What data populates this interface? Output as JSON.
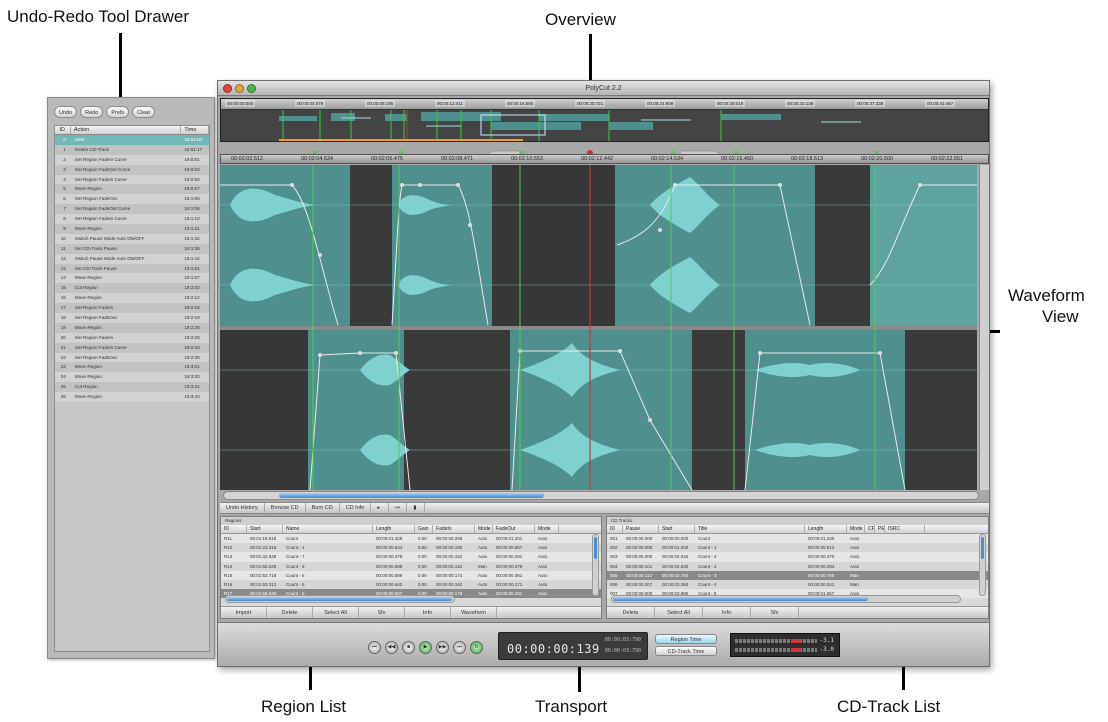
{
  "callouts": {
    "drawer": "Undo-Redo Tool Drawer",
    "overview": "Overview",
    "waveform_line1": "Waveform",
    "waveform_line2": "View",
    "region_list": "Region List",
    "transport": "Transport",
    "cd_track_list": "CD-Track List"
  },
  "window": {
    "title": "PolyCut 2.2"
  },
  "drawer": {
    "buttons": [
      "Undo",
      "Redo",
      "Prefs",
      "Clear"
    ],
    "columns": [
      "ID",
      "Action",
      "Time"
    ],
    "rows": [
      {
        "id": "0",
        "action": "Start",
        "time": "18:51:04",
        "selected": true
      },
      {
        "id": "1",
        "action": "Delete CD-Track",
        "time": "18:51:17"
      },
      {
        "id": "2",
        "action": "Set Region FadeIn Curve",
        "time": "19:0:51"
      },
      {
        "id": "3",
        "action": "Set Region FadeOut Curve",
        "time": "19:0:53"
      },
      {
        "id": "4",
        "action": "Set Region FadeIn Curve",
        "time": "19:0:55"
      },
      {
        "id": "5",
        "action": "Move Region",
        "time": "19:0:57"
      },
      {
        "id": "6",
        "action": "Set Region FadeOut",
        "time": "19:1:06"
      },
      {
        "id": "7",
        "action": "Set Region FadeOut Curve",
        "time": "19:1:08"
      },
      {
        "id": "8",
        "action": "Set Region FadeIn Curve",
        "time": "19:1:10"
      },
      {
        "id": "9",
        "action": "Move Region",
        "time": "19:1:21"
      },
      {
        "id": "10",
        "action": "Switch Pause Mode Auto ON/OFF",
        "time": "19:1:34"
      },
      {
        "id": "11",
        "action": "Set CD-Track Pause",
        "time": "19:1:38"
      },
      {
        "id": "12",
        "action": "Switch Pause Mode Auto ON/OFF",
        "time": "19:1:44"
      },
      {
        "id": "13",
        "action": "Set CD-Track Pause",
        "time": "19:1:51"
      },
      {
        "id": "14",
        "action": "Move Region",
        "time": "19:1:57"
      },
      {
        "id": "15",
        "action": "Cut Region",
        "time": "19:2:02"
      },
      {
        "id": "16",
        "action": "Move Region",
        "time": "19:2:12"
      },
      {
        "id": "17",
        "action": "Set Region FadeIn",
        "time": "19:2:16"
      },
      {
        "id": "18",
        "action": "Set Region FadeOut",
        "time": "19:2:19"
      },
      {
        "id": "19",
        "action": "Move Region",
        "time": "19:2:26"
      },
      {
        "id": "20",
        "action": "Set Region FadeIn",
        "time": "19:2:29"
      },
      {
        "id": "21",
        "action": "Set Region FadeIn Curve",
        "time": "19:2:33"
      },
      {
        "id": "22",
        "action": "Set Region FadeOut",
        "time": "19:2:36"
      },
      {
        "id": "23",
        "action": "Move Region",
        "time": "19:3:01"
      },
      {
        "id": "24",
        "action": "Move Region",
        "time": "19:3:33"
      },
      {
        "id": "25",
        "action": "Cut Region",
        "time": "19:3:41"
      },
      {
        "id": "26",
        "action": "Move Region",
        "time": "19:3:43"
      }
    ]
  },
  "overview": {
    "timestamps": [
      "00:00:00:000",
      "00:00:04:079",
      "00:00:08:195",
      "00:00:12:411",
      "00:00:16:590",
      "00:00:20:721",
      "00:00:24:909",
      "00:00:29:019",
      "00:00:33:138",
      "00:00:37:338",
      "00:00:41:467"
    ]
  },
  "ruler": {
    "timestamps": [
      "00:02:02.512",
      "00:02:04.534",
      "00:02:06.475",
      "00:02:08.471",
      "00:02:10.553",
      "00:02:12.442",
      "00:02:14.534",
      "00:02:16.450",
      "00:02:18.513",
      "00:02:20.500",
      "00:02:22.551"
    ]
  },
  "toolbar": {
    "buttons": [
      "Undo History",
      "Browse CD",
      "Burn CD",
      "CD Info"
    ]
  },
  "regions": {
    "title": "Regions",
    "columns": [
      "ID",
      "Start",
      "Name",
      "Length",
      "Gain",
      "FadeIn",
      "Mode",
      "FadeOut",
      "Mode"
    ],
    "rows": [
      {
        "id": "R11",
        "start": "00:01:18.818",
        "name": "Count",
        "length": "00:00:01.428",
        "gain": "0.00",
        "fadein": "00:00:00.268",
        "mode": "Auto",
        "fadeout": "00:00:01.201",
        "mode2": "Auto"
      },
      {
        "id": "R12",
        "start": "00:01:23.318",
        "name": "Count - 1",
        "length": "00:00:00.844",
        "gain": "0.00",
        "fadein": "00:00:00.190",
        "mode": "Auto",
        "fadeout": "00:00:00.657",
        "mode2": "Auto"
      },
      {
        "id": "R13",
        "start": "00:01:32.848",
        "name": "Count - 7",
        "length": "00:00:00.478",
        "gain": "0.00",
        "fadein": "00:00:00.152",
        "mode": "Auto",
        "fadeout": "00:00:00.281",
        "mode2": "Auto"
      },
      {
        "id": "R14",
        "start": "00:01:50.228",
        "name": "Count - 3",
        "length": "00:00:00.698",
        "gain": "0.00",
        "fadein": "00:00:00.118",
        "mode": "Man",
        "fadeout": "00:00:00.279",
        "mode2": "Auto"
      },
      {
        "id": "R15",
        "start": "00:01:52.718",
        "name": "Count - 5",
        "length": "00:00:00.588",
        "gain": "0.00",
        "fadein": "00:00:00.174",
        "mode": "Auto",
        "fadeout": "00:00:00.361",
        "mode2": "Auto"
      },
      {
        "id": "R16",
        "start": "00:01:53.313",
        "name": "Count - 5",
        "length": "00:00:00.542",
        "gain": "0.00",
        "fadein": "00:00:00.162",
        "mode": "Auto",
        "fadeout": "00:00:00.271",
        "mode2": "Auto"
      },
      {
        "id": "R17",
        "start": "00:01:59.635",
        "name": "Count - 6",
        "length": "00:00:00.927",
        "gain": "0.00",
        "fadein": "00:00:00.178",
        "mode": "Auto",
        "fadeout": "00:00:00.481",
        "mode2": "Auto",
        "selected": true
      }
    ],
    "buttons": [
      "Import",
      "Delete",
      "Select All",
      "Sfx",
      "Info",
      "Waveform"
    ]
  },
  "cdtracks": {
    "title": "CD Tracks",
    "columns": [
      "ID",
      "Pause",
      "Start",
      "Title",
      "Length",
      "Mode",
      "CP",
      "PE",
      "ISRC"
    ],
    "rows": [
      {
        "id": "001",
        "pause": "00:00:00.000",
        "start": "00:00:00.000",
        "title": "Count",
        "length": "00:00:01.230",
        "mode": "Auto"
      },
      {
        "id": "002",
        "pause": "00:00:00.000",
        "start": "00:00:01.200",
        "title": "Count - 1",
        "length": "00:00:00.613",
        "mode": "Auto"
      },
      {
        "id": "003",
        "pause": "00:00:00.000",
        "start": "00:00:02.045",
        "title": "Count - 2",
        "length": "00:00:00.470",
        "mode": "Auto"
      },
      {
        "id": "004",
        "pause": "00:00:00.101",
        "start": "00:00:02.830",
        "title": "Count - 2",
        "length": "00:00:00.294",
        "mode": "Auto"
      },
      {
        "id": "005",
        "pause": "00:00:00.113",
        "start": "00:00:02.750",
        "title": "Count - 3",
        "length": "00:00:00.780",
        "mode": "Man",
        "selected": true
      },
      {
        "id": "006",
        "pause": "00:00:00.207",
        "start": "00:00:03.393",
        "title": "Count - 4",
        "length": "00:00:00.041",
        "mode": "Man"
      },
      {
        "id": "007",
        "pause": "00:00:00.000",
        "start": "00:00:03.985",
        "title": "Count - 5",
        "length": "00:00:01.067",
        "mode": "Auto"
      }
    ],
    "buttons": [
      "Delete",
      "Select All",
      "Info",
      "Sfx"
    ]
  },
  "transport": {
    "time": "00:00:00:139",
    "time_top_small": "00:00:03:790",
    "time_bottom_small": "00:00:03:790",
    "mode_region": "Region Time",
    "mode_cdtrack": "CD-Track Time",
    "meter_top": "-3.1",
    "meter_bottom": "-3.0"
  },
  "colors": {
    "region": "#4f8f8d",
    "wave": "#7fd1cf",
    "marker_line": "#4fcf4f",
    "playhead": "#c8372f"
  }
}
